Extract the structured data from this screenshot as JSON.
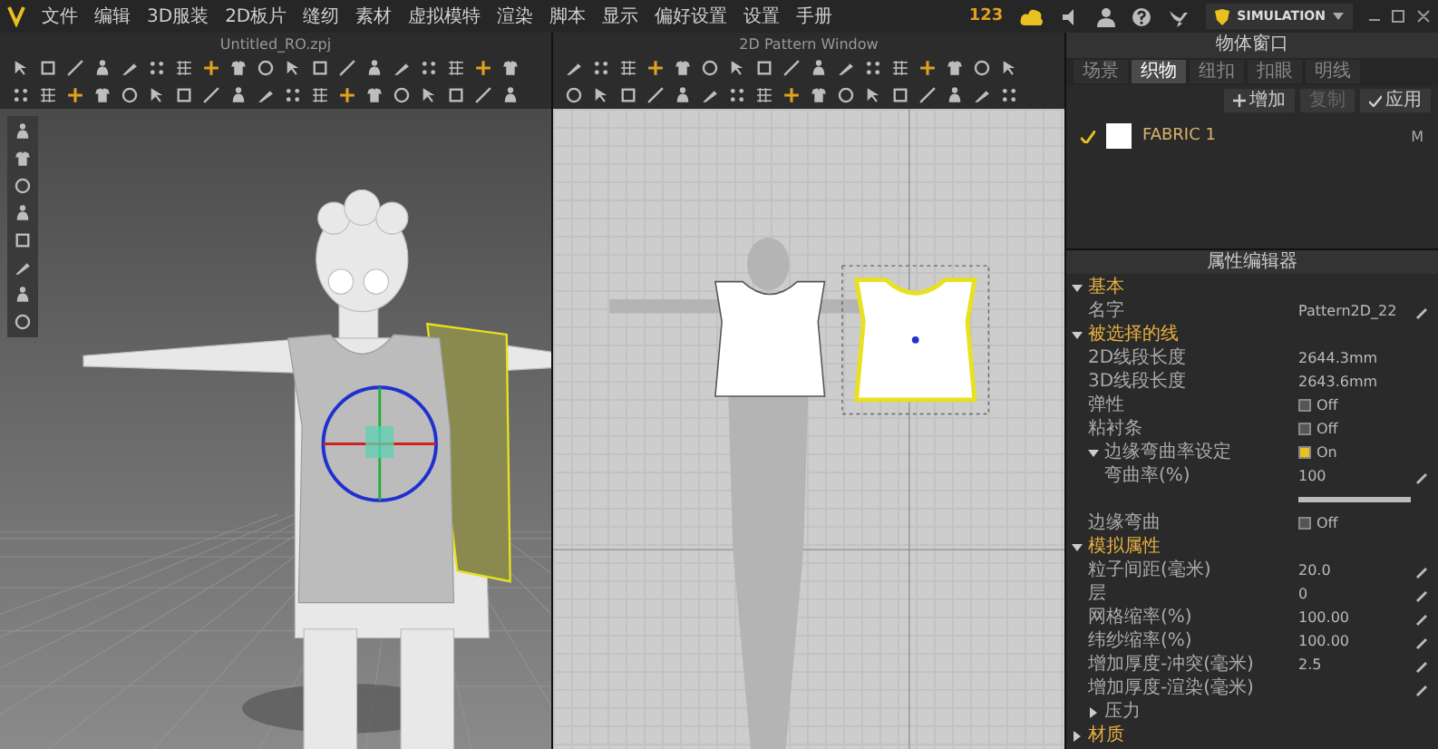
{
  "menu_bar": {
    "items": [
      "文件",
      "编辑",
      "3D服装",
      "2D板片",
      "缝纫",
      "素材",
      "虚拟模特",
      "渲染",
      "脚本",
      "显示",
      "偏好设置",
      "设置",
      "手册"
    ]
  },
  "status": {
    "counter": "123",
    "mode": "SIMULATION"
  },
  "window_3d": {
    "title": "Untitled_RO.zpj"
  },
  "window_2d": {
    "title": "2D Pattern Window",
    "pieces": [
      {
        "selected": false
      },
      {
        "selected": true
      }
    ]
  },
  "object_browser": {
    "title": "物体窗口",
    "tabs": [
      {
        "label": "场景",
        "selected": false
      },
      {
        "label": "织物",
        "selected": true
      },
      {
        "label": "纽扣",
        "selected": false
      },
      {
        "label": "扣眼",
        "selected": false
      },
      {
        "label": "明线",
        "selected": false
      }
    ],
    "buttons": [
      {
        "kind": "add",
        "label": "增加",
        "disabled": false
      },
      {
        "kind": "copy",
        "label": "复制",
        "disabled": true
      },
      {
        "kind": "apply",
        "label": "应用",
        "disabled": false
      }
    ],
    "fabrics": [
      {
        "name": "FABRIC 1",
        "badge": "M",
        "checked": true
      }
    ]
  },
  "property_editor": {
    "title": "属性编辑器",
    "sections": [
      {
        "label": "基本",
        "expanded": true,
        "children": [
          {
            "kind": "text",
            "label": "名字",
            "value": "Pattern2D_22",
            "editable": true
          }
        ]
      },
      {
        "label": "被选择的线",
        "expanded": true,
        "children": [
          {
            "kind": "text",
            "label": "2D线段长度",
            "value": "2644.3mm",
            "editable": false
          },
          {
            "kind": "text",
            "label": "3D线段长度",
            "value": "2643.6mm",
            "editable": false
          },
          {
            "kind": "toggle",
            "label": "弹性",
            "value": "Off",
            "checked": false
          },
          {
            "kind": "toggle",
            "label": "粘衬条",
            "value": "Off",
            "checked": false
          },
          {
            "kind": "group",
            "label": "边缘弯曲率设定",
            "value": "On",
            "checked": true,
            "expanded": true,
            "children": [
              {
                "kind": "slider",
                "label": "弯曲率(%)",
                "value": "100",
                "level": 1.0,
                "editable": true
              }
            ]
          },
          {
            "kind": "toggle",
            "label": "边缘弯曲",
            "value": "Off",
            "checked": false
          }
        ]
      },
      {
        "label": "模拟属性",
        "expanded": true,
        "children": [
          {
            "kind": "text",
            "label": "粒子间距(毫米)",
            "value": "20.0",
            "editable": true
          },
          {
            "kind": "text",
            "label": "层",
            "value": "0",
            "editable": true
          },
          {
            "kind": "text",
            "label": "网格缩率(%)",
            "value": "100.00",
            "editable": true
          },
          {
            "kind": "text",
            "label": "纬纱缩率(%)",
            "value": "100.00",
            "editable": true
          },
          {
            "kind": "text",
            "label": "增加厚度-冲突(毫米)",
            "value": "2.5",
            "editable": true
          },
          {
            "kind": "text",
            "label": "增加厚度-渲染(毫米)",
            "editable": true
          },
          {
            "kind": "group",
            "label": "压力",
            "expanded": false
          }
        ]
      },
      {
        "label": "材质",
        "expanded": false
      }
    ]
  }
}
